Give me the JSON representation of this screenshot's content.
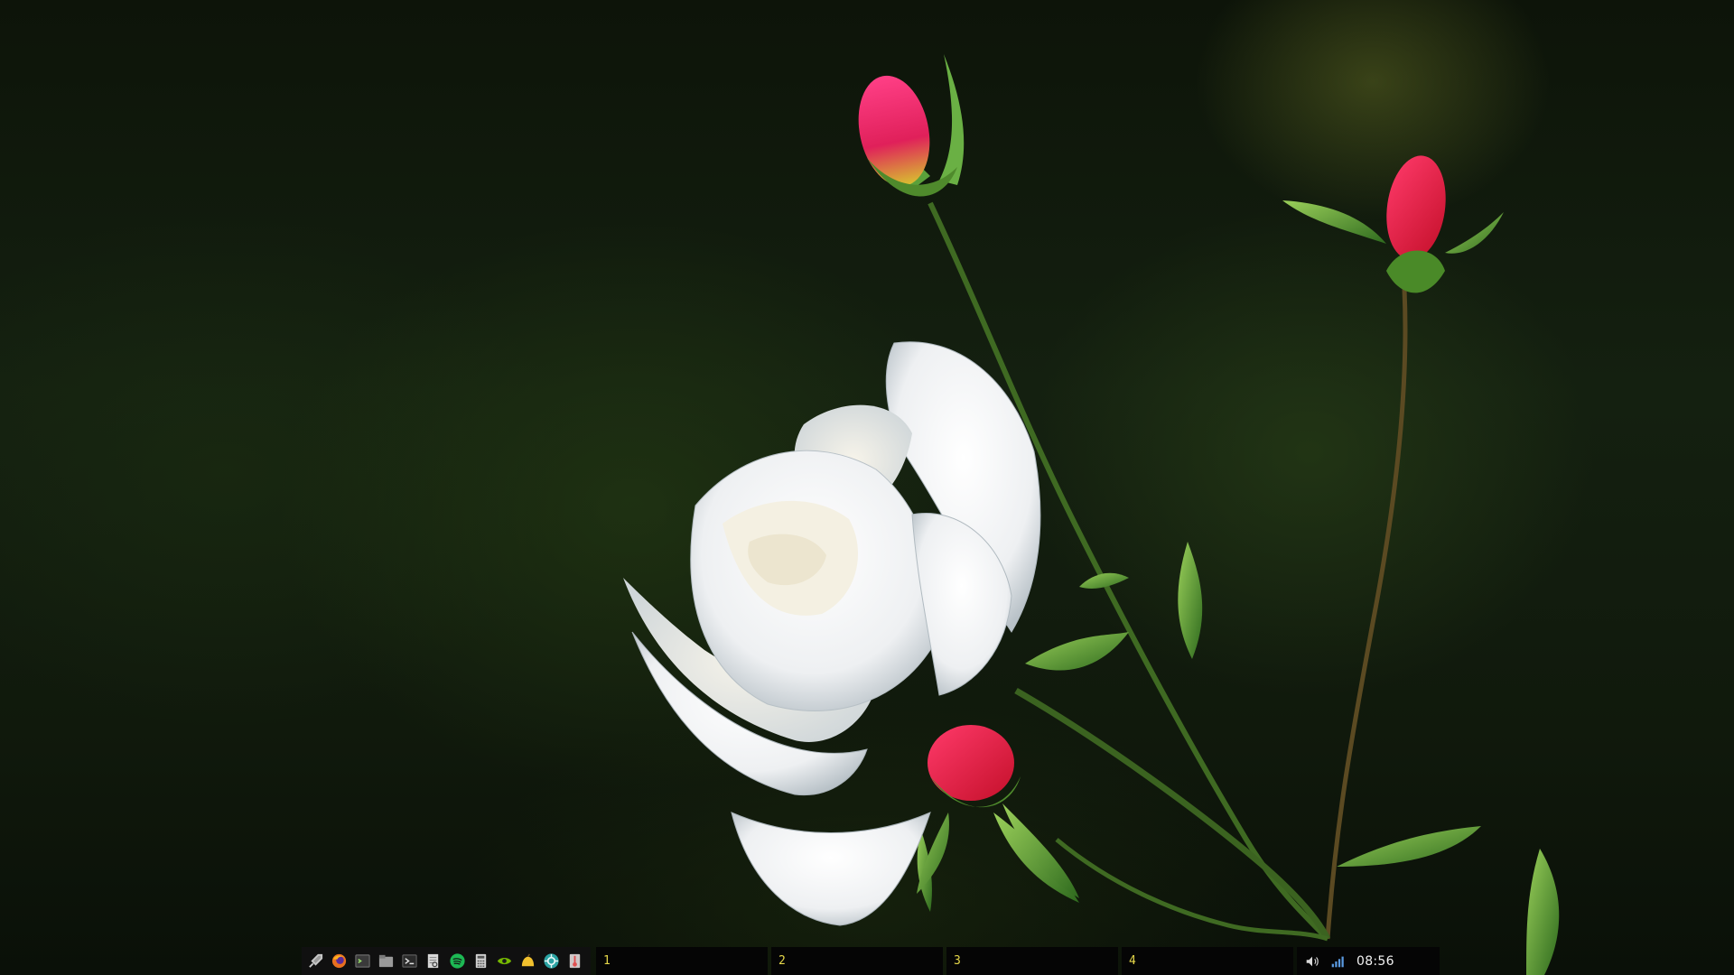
{
  "desktop": {
    "wallpaper": "white-rose-with-pink-buds"
  },
  "panel": {
    "launchers": [
      {
        "name": "rocket-launcher-icon",
        "color": "#c8c8c8"
      },
      {
        "name": "firefox-icon",
        "color": "#e8701f"
      },
      {
        "name": "terminal-icon",
        "color": "#6a6a6a"
      },
      {
        "name": "file-manager-icon",
        "color": "#9a9a9a"
      },
      {
        "name": "terminal-alt-icon",
        "color": "#5a5a5a"
      },
      {
        "name": "text-editor-icon",
        "color": "#b8b8b8"
      },
      {
        "name": "spotify-icon",
        "color": "#1db954"
      },
      {
        "name": "calculator-icon",
        "color": "#d0d0d0"
      },
      {
        "name": "nvidia-settings-icon",
        "color": "#76b900"
      },
      {
        "name": "cherrytree-icon",
        "color": "#f2c12e"
      },
      {
        "name": "system-monitor-icon",
        "color": "#2aa3a3"
      },
      {
        "name": "thermometer-icon",
        "color": "#e05050"
      }
    ],
    "workspaces": [
      {
        "label": "1"
      },
      {
        "label": "2"
      },
      {
        "label": "3"
      },
      {
        "label": "4"
      }
    ],
    "tray": {
      "volume_icon": "volume-icon",
      "network_icon": "signal-bars-icon",
      "clock": "08:56"
    },
    "accent": "#e6d84a"
  }
}
